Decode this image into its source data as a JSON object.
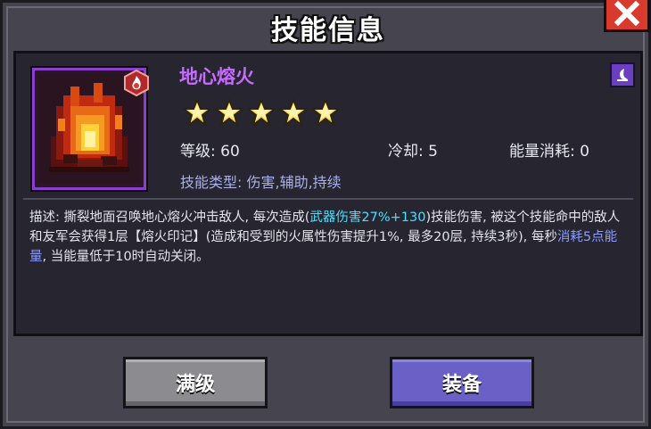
{
  "dialog": {
    "title": "技能信息",
    "close_icon": "close-x-icon"
  },
  "skill": {
    "name": "地心熔火",
    "name_color": "#c86cff",
    "stars": 5,
    "level": "等级: 60",
    "cooldown": "冷却: 5",
    "energy": "能量消耗: 0",
    "type": "技能类型: 伤害,辅助,持续",
    "element_icon": "fire-element-icon",
    "type_icon": "spell-book-icon"
  },
  "description": {
    "part1": "描述: 撕裂地面召唤地心熔火冲击敌人, 每次造成(",
    "hl1": "武器伤害27%+130",
    "part2": ")技能伤害, 被这个技能命中的敌人和友军会获得1层【熔火印记】(造成和受到的火属性伤害提升1%, 最多20层, 持续3秒), 每秒",
    "hl2": "消耗5点能量",
    "part3": ", 当能量低于10时自动关闭。"
  },
  "buttons": {
    "max_level": "满级",
    "equip": "装备"
  }
}
